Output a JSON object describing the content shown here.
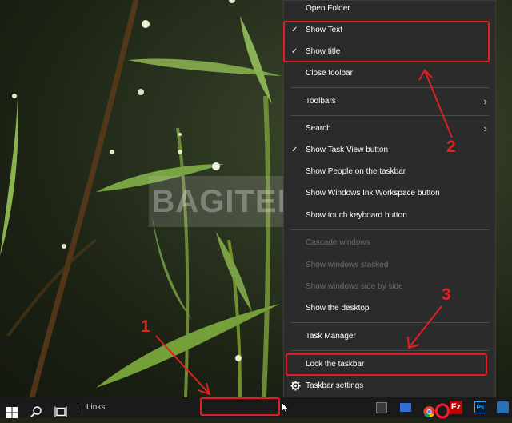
{
  "menu": {
    "items": [
      {
        "label": "Open Folder",
        "checked": false,
        "submenu": false,
        "disabled": false
      },
      {
        "label": "Show Text",
        "checked": true,
        "submenu": false,
        "disabled": false
      },
      {
        "label": "Show title",
        "checked": true,
        "submenu": false,
        "disabled": false
      },
      {
        "label": "Close toolbar",
        "checked": false,
        "submenu": false,
        "disabled": false
      },
      {
        "label": "Toolbars",
        "checked": false,
        "submenu": true,
        "disabled": false
      },
      {
        "label": "Search",
        "checked": false,
        "submenu": true,
        "disabled": false
      },
      {
        "label": "Show Task View button",
        "checked": true,
        "submenu": false,
        "disabled": false
      },
      {
        "label": "Show People on the taskbar",
        "checked": false,
        "submenu": false,
        "disabled": false
      },
      {
        "label": "Show Windows Ink Workspace button",
        "checked": false,
        "submenu": false,
        "disabled": false
      },
      {
        "label": "Show touch keyboard button",
        "checked": false,
        "submenu": false,
        "disabled": false
      },
      {
        "label": "Cascade windows",
        "checked": false,
        "submenu": false,
        "disabled": true
      },
      {
        "label": "Show windows stacked",
        "checked": false,
        "submenu": false,
        "disabled": true
      },
      {
        "label": "Show windows side by side",
        "checked": false,
        "submenu": false,
        "disabled": true
      },
      {
        "label": "Show the desktop",
        "checked": false,
        "submenu": false,
        "disabled": false
      },
      {
        "label": "Task Manager",
        "checked": false,
        "submenu": false,
        "disabled": false
      },
      {
        "label": "Lock the taskbar",
        "checked": false,
        "submenu": false,
        "disabled": false
      },
      {
        "label": "Taskbar settings",
        "checked": false,
        "submenu": false,
        "disabled": false,
        "icon": "gear-icon"
      }
    ],
    "check_glyph": "✓",
    "arrow_glyph": "›"
  },
  "taskbar": {
    "links_label": "Links",
    "pinned_icons": [
      "windows-start-icon",
      "search-icon",
      "task-view-icon",
      "store-icon",
      "mail-icon",
      "chrome-icon",
      "opera-icon",
      "filezilla-icon",
      "photoshop-icon",
      "app-icon"
    ]
  },
  "annotations": {
    "labels": [
      "1",
      "2",
      "3"
    ],
    "color": "#e02020"
  },
  "watermark": {
    "text": "BAGITEKNO"
  }
}
